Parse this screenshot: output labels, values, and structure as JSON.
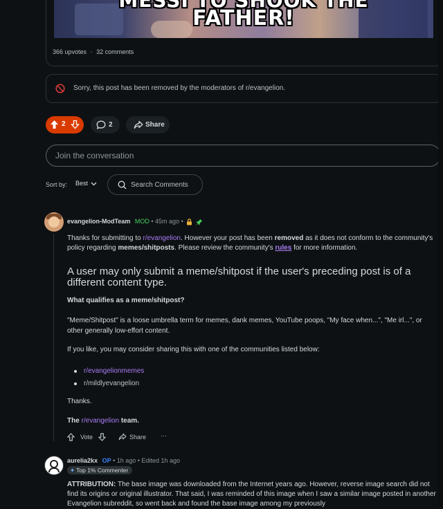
{
  "post": {
    "meme_top_text": "MESSI TO SHOOK THE",
    "meme_text": "FATHER!",
    "upvotes_text": "366 upvotes",
    "separator": "·",
    "comments_text": "32 comments"
  },
  "removed_notice": "Sorry, this post has been removed by the moderators of r/evangelion.",
  "actions": {
    "vote_count": "2",
    "comment_count": "2",
    "share_label": "Share"
  },
  "join": {
    "placeholder": "Join the conversation"
  },
  "sort": {
    "label": "Sort by:",
    "value": "Best",
    "search_label": "Search Comments"
  },
  "comments": [
    {
      "author": "evangelion-ModTeam",
      "badge": "MOD",
      "time": " • 45m ago • ",
      "intro_1": "Thanks for submitting to ",
      "intro_link": "r/evangelion",
      "intro_2": ". However your post has been ",
      "intro_bold": "removed",
      "intro_3": " as it does not conform to the community's policy regarding ",
      "intro_bold2": "memes/shitposts",
      "intro_4": ". Please review the community's ",
      "intro_rules": "rules",
      "intro_5": " for more information.",
      "heading": "A user may only submit a meme/shitpost if the user's preceding post is of a different content type.",
      "question": "What qualifies as a meme/shitpost?",
      "definition": "\"Meme/Shitpost\" is a loose umbrella term for memes, dank memes, YouTube poops, \"My face when...\", \"Me irl...\", or other generally low-effort content.",
      "share_text": "If you like, you may consider sharing this with one of the communities listed below:",
      "communities": [
        "r/evangelionmemes",
        "r/mildlyevangelion"
      ],
      "thanks": "Thanks.",
      "team_1": "The ",
      "team_link": "r/evangelion",
      "team_2": " team.",
      "vote_label": "Vote",
      "share_label": "Share",
      "more": "···"
    },
    {
      "author": "aurelia2kx",
      "badge": "OP",
      "time": " • 1h ago • Edited 1h ago",
      "flair": "Top 1% Commenter",
      "body_bold": "ATTRIBUTION:",
      "body": " The base image was downloaded from the Internet years ago. However, reverse image search did not find its origins or original illustrator. That said, I was reminded of this image when I saw a similar image posted in another Evangelion subreddit, so went back and found the base image among my previously"
    }
  ],
  "colors": {
    "background": "#0e1113",
    "upvote_accent": "#d93a00",
    "link": "#a87cf5",
    "mod_green": "#46d160",
    "op_blue": "#3b82f6",
    "removed_icon": "#e03a3a"
  },
  "icons": [
    "ban-icon",
    "upvote-icon",
    "downvote-icon",
    "comment-icon",
    "share-icon",
    "chevron-down-icon",
    "search-icon",
    "lock-icon",
    "pin-icon",
    "more-icon"
  ]
}
